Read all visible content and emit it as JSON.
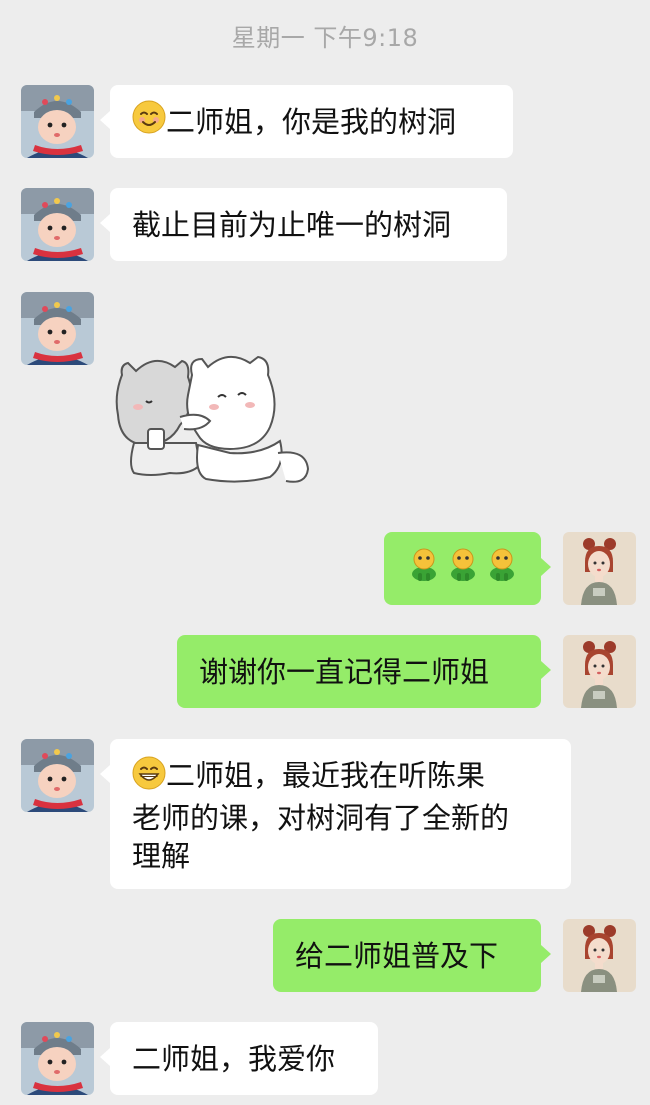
{
  "timestamp": "星期一 下午9:18",
  "messages": [
    {
      "side": "in",
      "emoji": "smiling-face-icon",
      "text": "二师姐，你是我的树洞"
    },
    {
      "side": "in",
      "text": "截止目前为止唯一的树洞"
    },
    {
      "side": "in",
      "sticker": "hugging-cats-sticker"
    },
    {
      "side": "out",
      "emoji": "green-figure-icon x3"
    },
    {
      "side": "out",
      "text": "谢谢你一直记得二师姐"
    },
    {
      "side": "in",
      "emoji": "grinning-face-icon",
      "lines": [
        "二师姐，最近我在听陈果",
        "老师的课，对树洞有了全新的",
        "理解"
      ]
    },
    {
      "side": "out",
      "text": "给二师姐普及下"
    },
    {
      "side": "in",
      "text": "二师姐，我爱你"
    }
  ],
  "colors": {
    "background": "#ededed",
    "incoming_bubble": "#ffffff",
    "outgoing_bubble": "#95ec69",
    "timestamp": "#a8a8a8"
  }
}
